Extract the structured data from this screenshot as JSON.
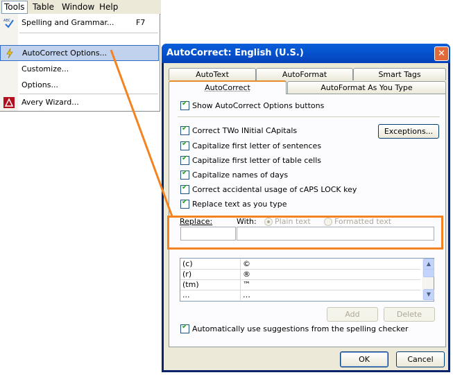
{
  "menubar": {
    "items": [
      "Tools",
      "Table",
      "Window",
      "Help"
    ]
  },
  "menu": {
    "items": [
      {
        "label": "Spelling and Grammar...",
        "shortcut": "F7"
      },
      {
        "label": "AutoCorrect Options..."
      },
      {
        "label": "Customize..."
      },
      {
        "label": "Options..."
      },
      {
        "label": "Avery Wizard..."
      }
    ]
  },
  "dialog": {
    "title": "AutoCorrect: English (U.S.)",
    "close": "✕",
    "tabs_top": [
      "AutoText",
      "AutoFormat",
      "Smart Tags"
    ],
    "tabs_bottom": [
      "AutoCorrect",
      "AutoFormat As You Type"
    ],
    "show_options": "Show AutoCorrect Options buttons",
    "options": [
      "Correct TWo INitial CApitals",
      "Capitalize first letter of sentences",
      "Capitalize first letter of table cells",
      "Capitalize names of days",
      "Correct accidental usage of cAPS LOCK key"
    ],
    "exceptions": "Exceptions...",
    "replace_as_type": "Replace text as you type",
    "replace_label": "Replace:",
    "with_label": "With:",
    "plain_text": "Plain text",
    "formatted_text": "Formatted text",
    "replace_value": "",
    "with_value": "",
    "list": [
      {
        "from": "(c)",
        "to": "©"
      },
      {
        "from": "(r)",
        "to": "®"
      },
      {
        "from": "(tm)",
        "to": "™"
      },
      {
        "from": "...",
        "to": "…"
      }
    ],
    "add": "Add",
    "delete": "Delete",
    "auto_suggest": "Automatically use suggestions from the spelling checker",
    "ok": "OK",
    "cancel": "Cancel"
  },
  "colors": {
    "highlight": "#f58220",
    "title_bar": "#0654d1"
  }
}
